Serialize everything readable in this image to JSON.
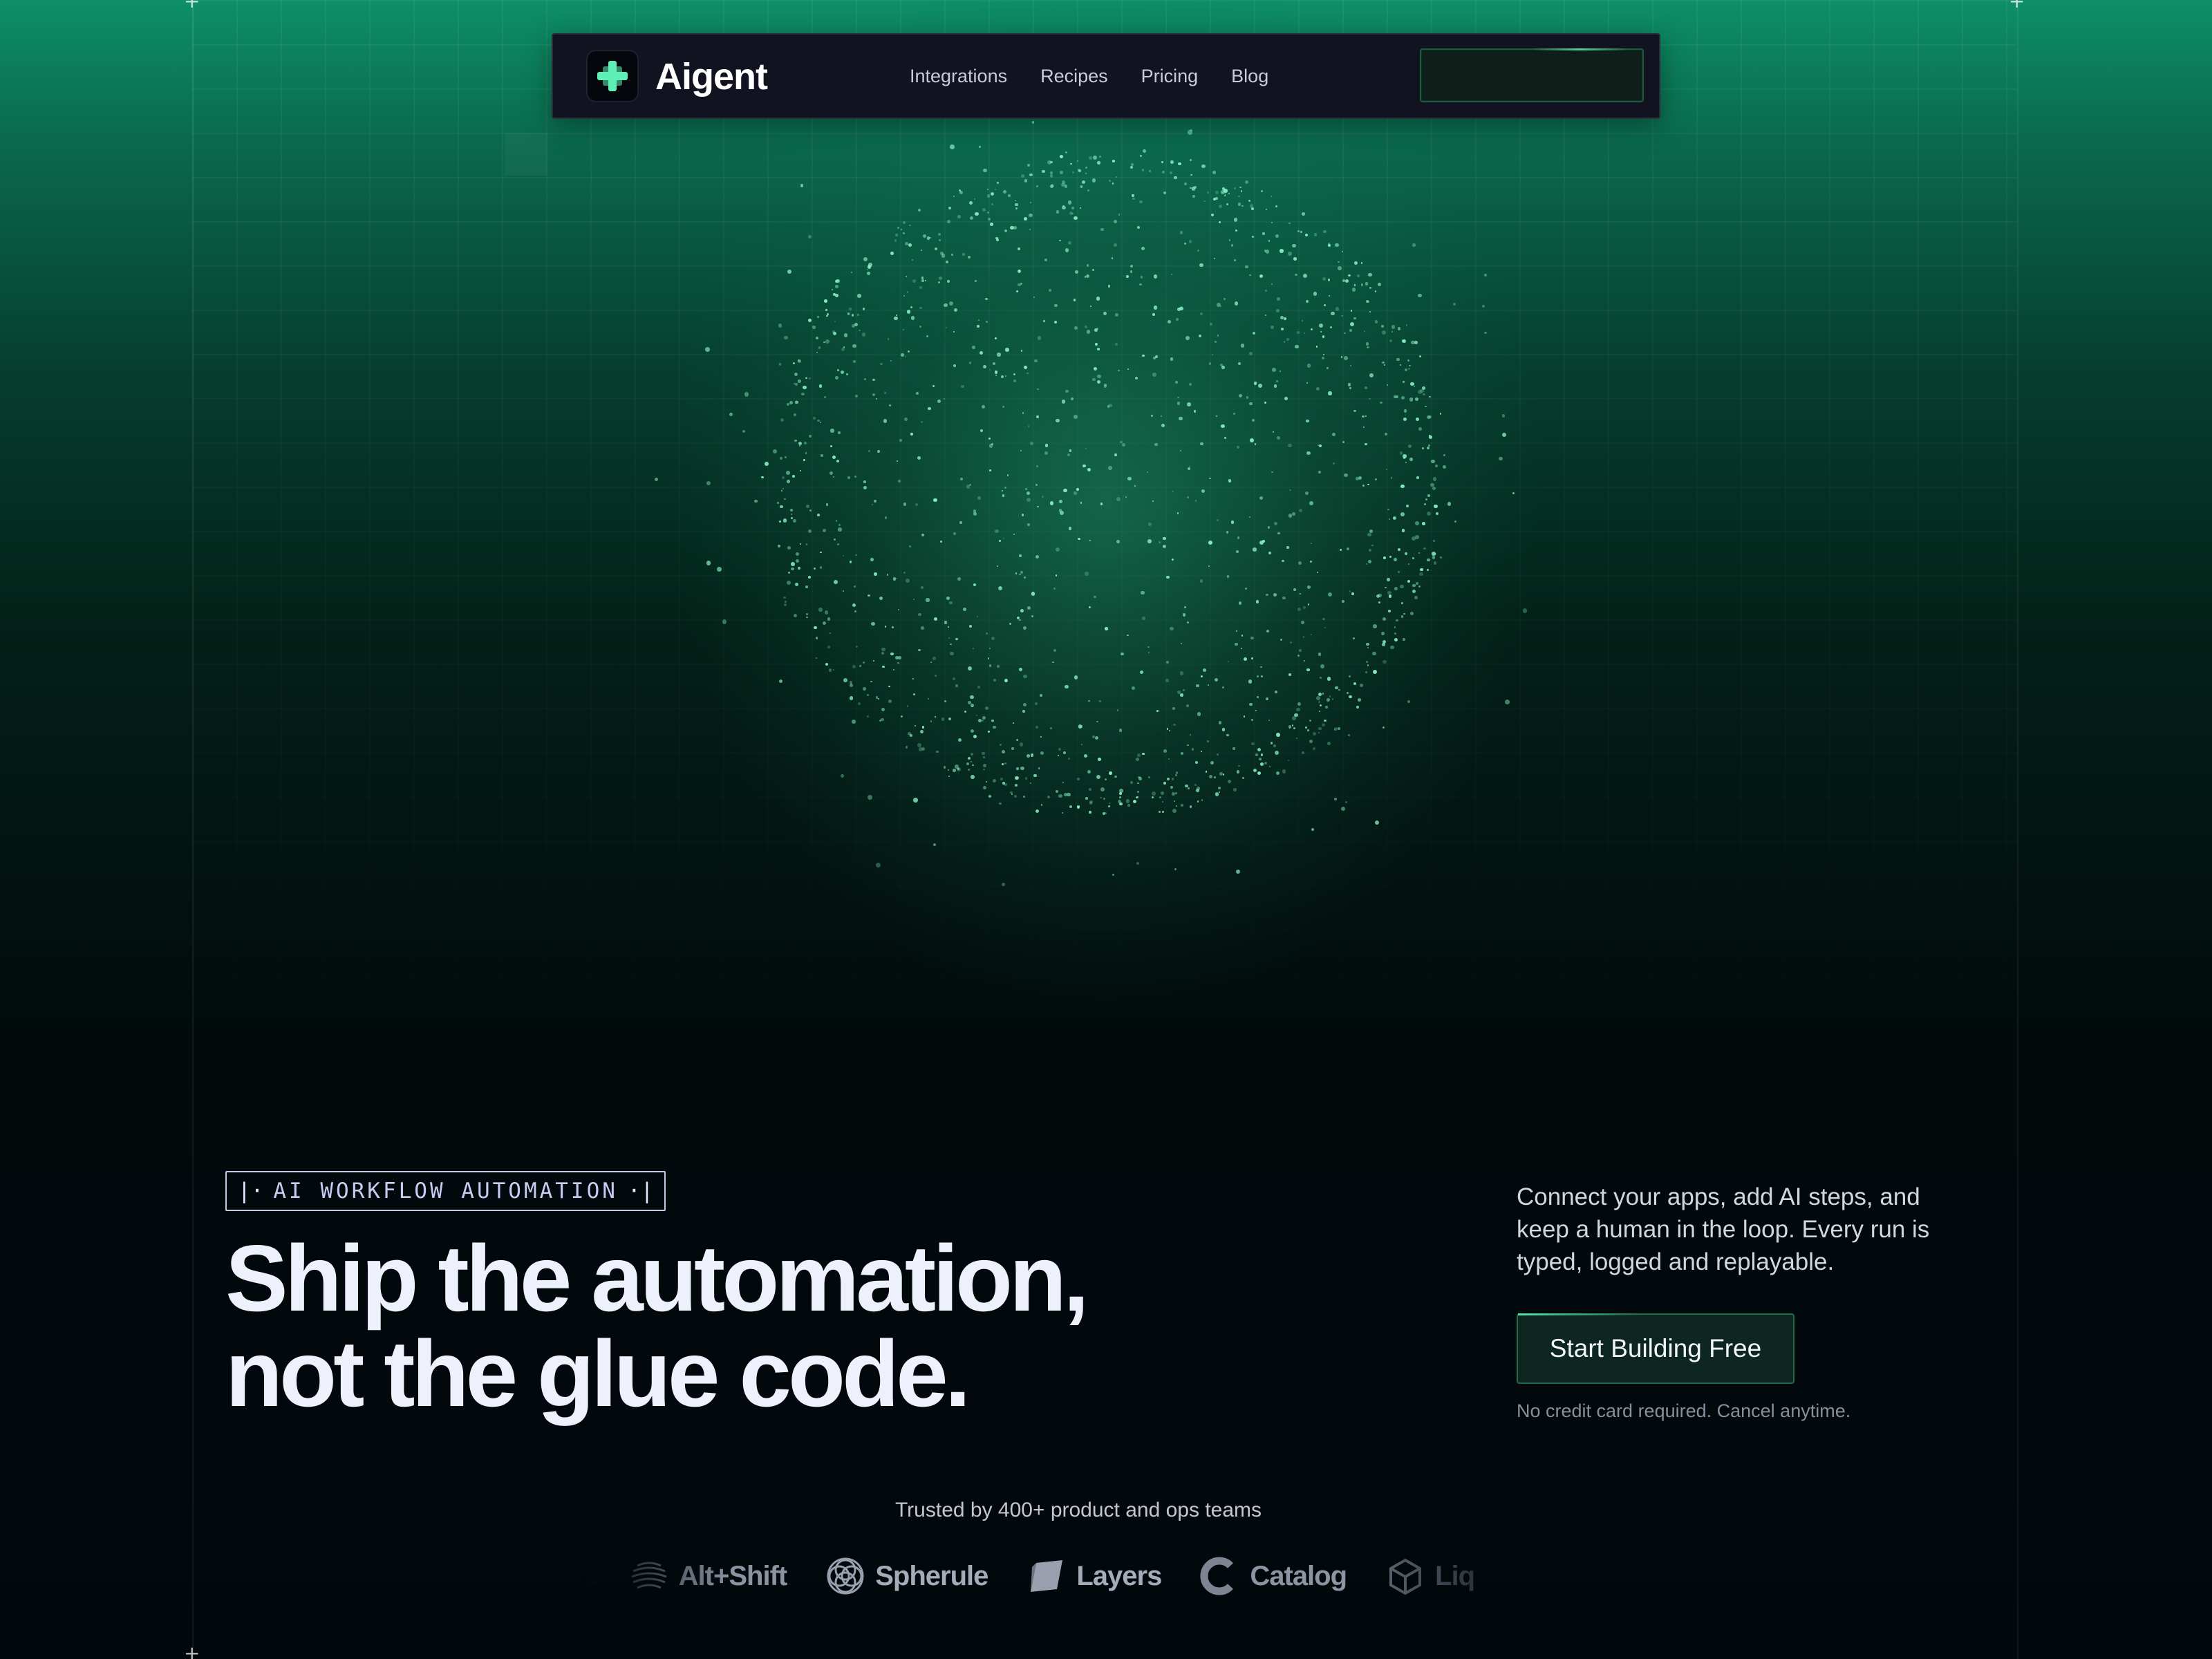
{
  "brand": {
    "name": "Aigent",
    "logo_icon": "plus-pixel-icon",
    "accent": "#5ef0b6"
  },
  "nav": {
    "links": [
      {
        "label": "Integrations"
      },
      {
        "label": "Recipes"
      },
      {
        "label": "Pricing"
      },
      {
        "label": "Blog"
      }
    ],
    "cta_label": ""
  },
  "hero": {
    "eyebrow": "AI WORKFLOW AUTOMATION",
    "headline_line1": "Ship the automation,",
    "headline_line2": "not the glue code.",
    "description": "Connect your apps, add AI steps, and keep a human in the loop. Every run is typed, logged and replayable.",
    "primary_cta": "Start Building Free",
    "fineprint": "No credit card required. Cancel anytime."
  },
  "trusted": {
    "text": "Trusted by 400+ product and ops teams",
    "logos": [
      {
        "name": "Alt+Shift",
        "icon": "wave-sphere-icon"
      },
      {
        "name": "Spherule",
        "icon": "ring-sphere-icon"
      },
      {
        "name": "Layers",
        "icon": "layers-icon"
      },
      {
        "name": "Catalog",
        "icon": "catalog-c-icon"
      },
      {
        "name": "Liq",
        "icon": "cube-icon"
      }
    ]
  },
  "colors": {
    "background": "#02070b",
    "top_glow": "#0d8f67",
    "nav_bg": "#121320",
    "button_bg": "#0d2620",
    "button_border": "#1e6b4e",
    "particle": "#8af0c8"
  }
}
